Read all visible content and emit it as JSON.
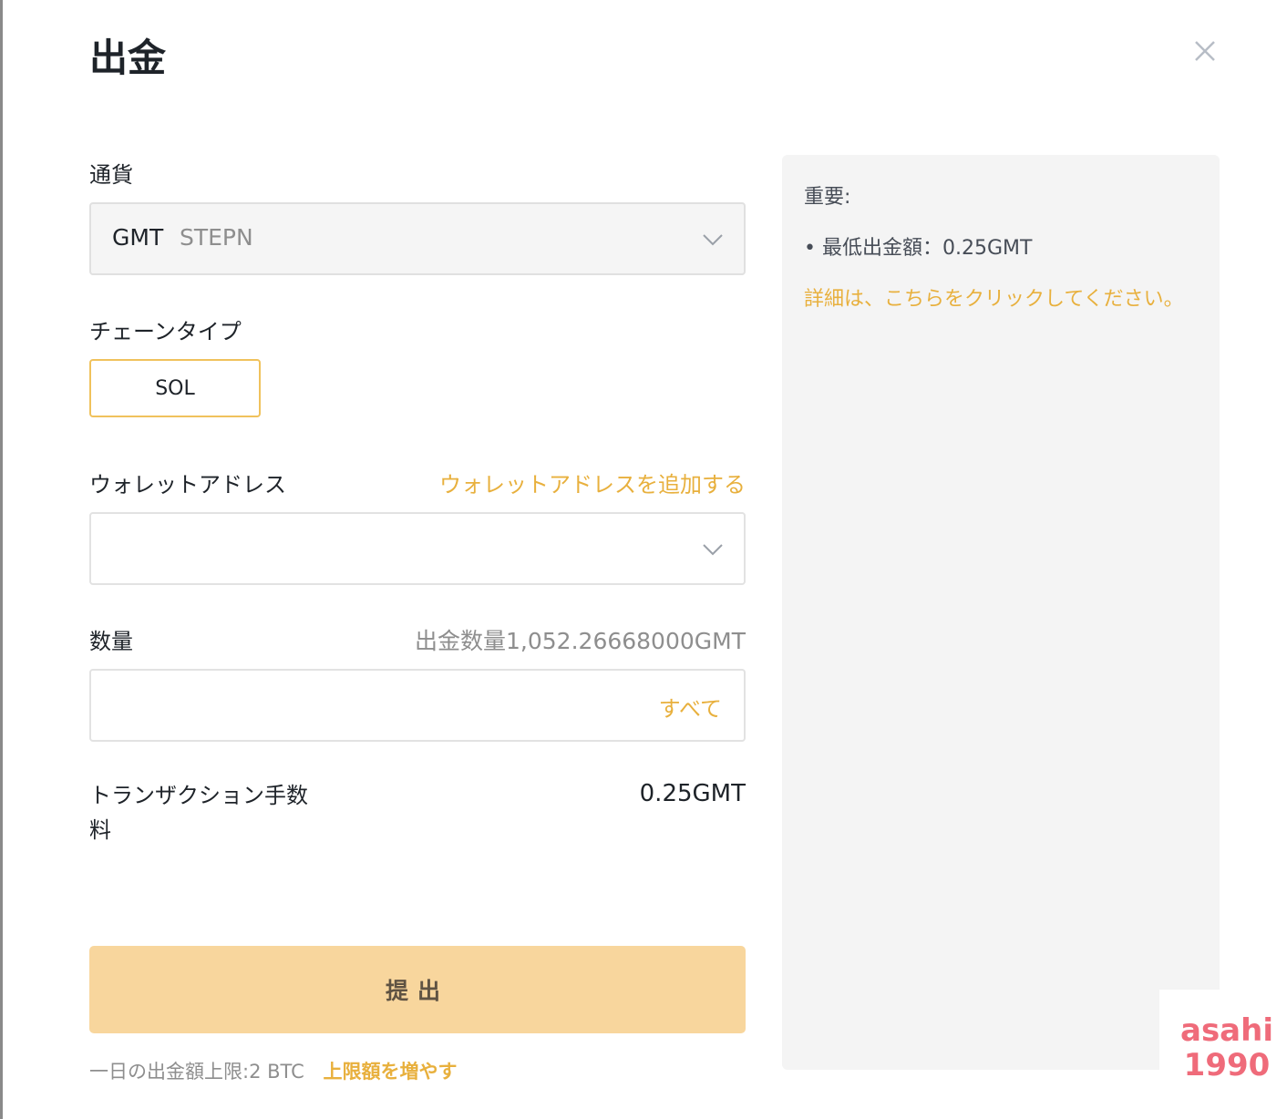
{
  "dialog": {
    "title": "出金"
  },
  "currency": {
    "label": "通貨",
    "code": "GMT",
    "name": "STEPN"
  },
  "chain": {
    "label": "チェーンタイプ",
    "selected": "SOL"
  },
  "wallet": {
    "label": "ウォレットアドレス",
    "add_link": "ウォレットアドレスを追加する",
    "value": ""
  },
  "amount": {
    "label": "数量",
    "available": "出金数量1,052.26668000GMT",
    "max_link": "すべて",
    "value": ""
  },
  "fee": {
    "label": "トランザクション手数料",
    "value": "0.25GMT"
  },
  "submit": {
    "label": "提出"
  },
  "limit": {
    "text": "一日の出金額上限:2 BTC",
    "link": "上限額を増やす"
  },
  "info": {
    "title": "重要:",
    "min_withdraw": "• 最低出金額：0.25GMT",
    "details_link": "詳細は、こちらをクリックしてください。"
  },
  "watermark": {
    "line1": "asahi",
    "line2": "1990"
  },
  "colors": {
    "accent": "#e8b03d",
    "button_bg": "#f8d69d",
    "panel_bg": "#f4f4f4"
  },
  "icons": {
    "close": "close-icon",
    "chevron": "chevron-down-icon"
  }
}
